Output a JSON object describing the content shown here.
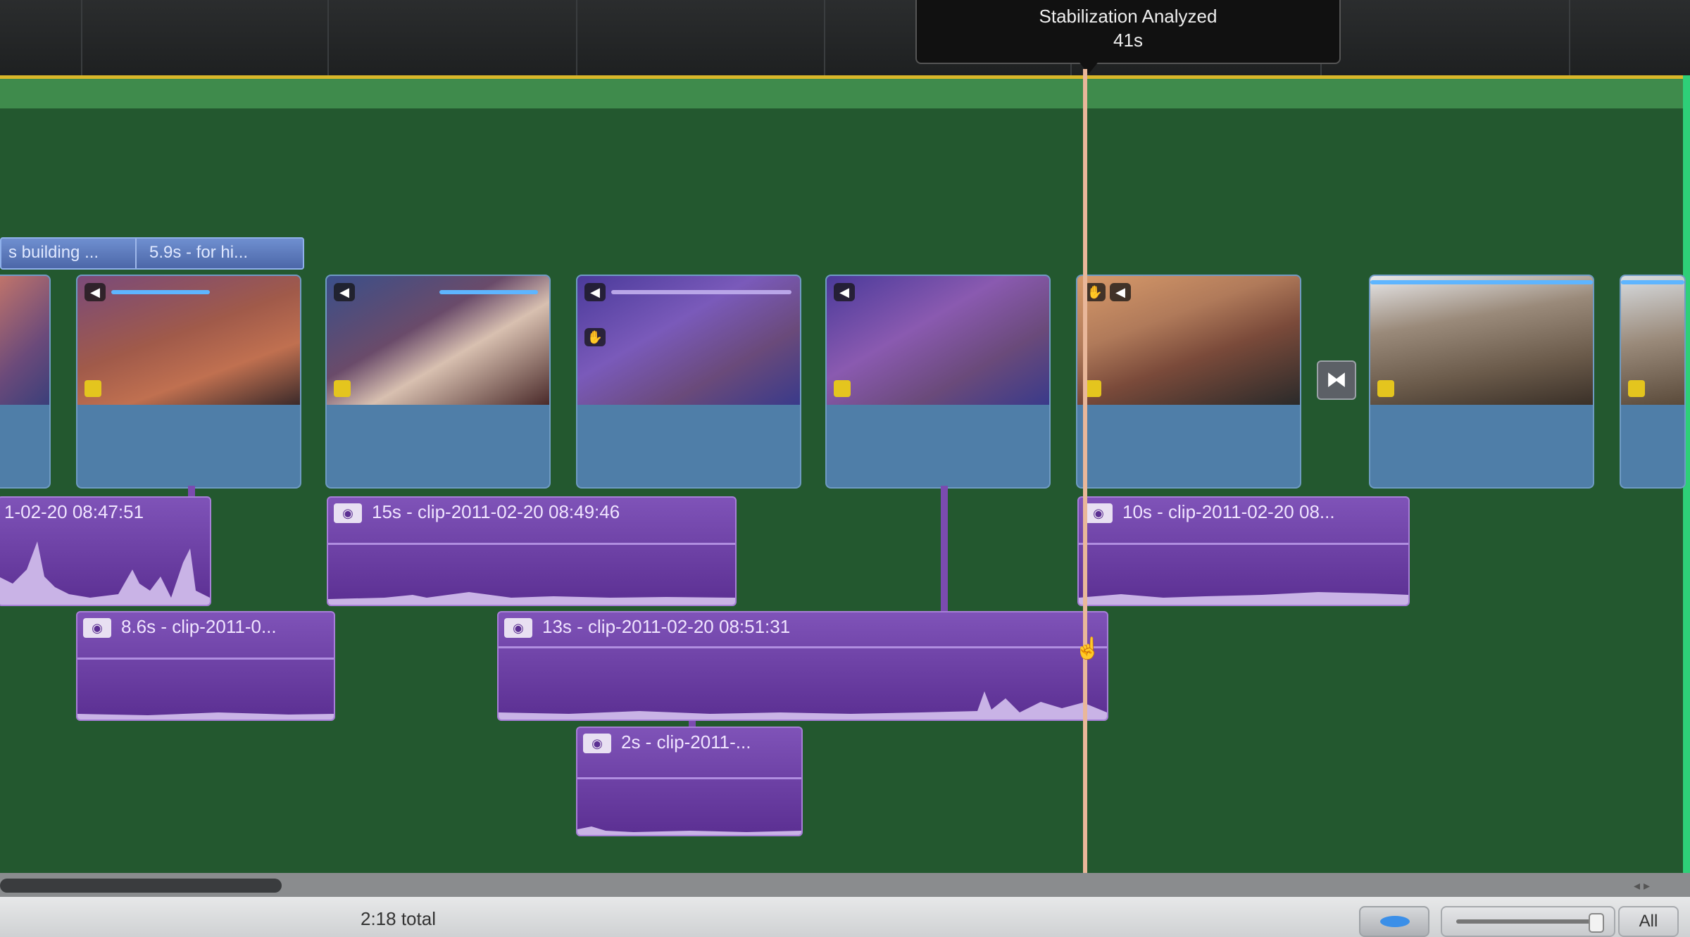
{
  "tooltip": {
    "status": "Stabilization Analyzed",
    "duration": "41s"
  },
  "title_clips": {
    "a": "s building ...",
    "b": "5.9s - for hi..."
  },
  "audio_clips": [
    {
      "label": "1-02-20 08:47:51"
    },
    {
      "label": "15s - clip-2011-02-20 08:49:46"
    },
    {
      "label": "10s - clip-2011-02-20 08..."
    },
    {
      "label": "8.6s - clip-2011-0..."
    },
    {
      "label": "13s - clip-2011-02-20 08:51:31"
    },
    {
      "label": "2s - clip-2011-..."
    }
  ],
  "transition_icon": "transition-bowtie-icon",
  "footer": {
    "total": "2:18 total",
    "all_label": "All"
  },
  "colors": {
    "timeline_bg": "#23582f",
    "video_clip": "#4f7ea8",
    "audio_clip": "#6a3fa5",
    "playhead": "#e9b79a",
    "yellow_marker": "#d9b72a"
  }
}
